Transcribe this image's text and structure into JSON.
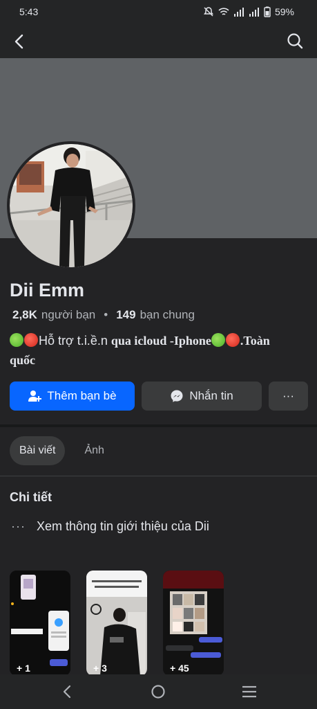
{
  "status_bar": {
    "time": "5:43",
    "battery": "59%"
  },
  "profile": {
    "name": "Dii Emm",
    "friends_count": "2,8K",
    "friends_label": "người bạn",
    "mutual_count": "149",
    "mutual_label": "bạn chung",
    "bio_line_1": "Hỗ trợ t.i.ề.n",
    "bio_line_1b": "qua icloud -Iphone",
    "bio_line_1c": ".Toàn",
    "bio_line_2": "quốc"
  },
  "actions": {
    "add_friend": "Thêm bạn bè",
    "message": "Nhắn tin",
    "more": "···"
  },
  "tabs": [
    {
      "label": "Bài viết",
      "active": true
    },
    {
      "label": "Ảnh",
      "active": false
    }
  ],
  "details": {
    "title": "Chi tiết",
    "intro_link": "Xem thông tin giới thiệu của Dii",
    "ellipsis": "···"
  },
  "featured": [
    {
      "count": "+ 1"
    },
    {
      "count": "+ 3"
    },
    {
      "count": "+ 45"
    }
  ],
  "icons": {
    "back": "back-arrow-icon",
    "search": "search-icon",
    "add_friend": "add-person-icon",
    "messenger": "messenger-icon"
  },
  "colors": {
    "accent": "#0866ff",
    "background": "#232325",
    "cover": "#5f6265",
    "secondary_button": "#3a3b3c"
  }
}
